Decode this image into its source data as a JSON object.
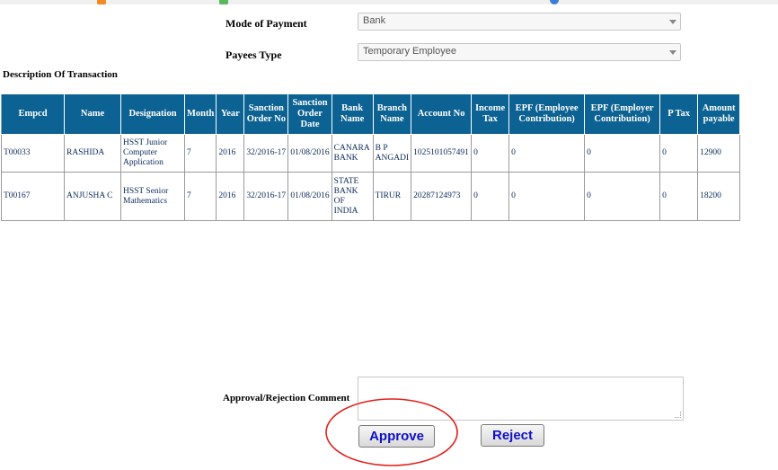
{
  "form": {
    "mode_label": "Mode of Payment",
    "mode_value": "Bank",
    "payee_label": "Payees Type",
    "payee_value": "Temporary Employee"
  },
  "section_title": "Description Of Transaction",
  "table": {
    "headers": [
      "Empcd",
      "Name",
      "Designation",
      "Month",
      "Year",
      "Sanction Order No",
      "Sanction Order Date",
      "Bank Name",
      "Branch Name",
      "Account No",
      "Income Tax",
      "EPF (Employee Contribution)",
      "EPF (Employer Contribution)",
      "P Tax",
      "Amount payable"
    ],
    "rows": [
      [
        "T00033",
        "RASHIDA",
        "HSST Junior Computer Application",
        "7",
        "2016",
        "32/2016-17",
        "01/08/2016",
        "CANARA BANK",
        "B P ANGADI",
        "1025101057491",
        "0",
        "0",
        "0",
        "0",
        "12900"
      ],
      [
        "T00167",
        "ANJUSHA C",
        "HSST Senior Mathematics",
        "7",
        "2016",
        "32/2016-17",
        "01/08/2016",
        "STATE BANK OF INDIA",
        "TIRUR",
        "20287124973",
        "0",
        "0",
        "0",
        "0",
        "18200"
      ]
    ]
  },
  "comment": {
    "label": "Approval/Rejection Comment",
    "value": ""
  },
  "buttons": {
    "approve": "Approve",
    "reject": "Reject"
  },
  "colors": {
    "header_bg": "#0c6292",
    "highlight": "#e0201c",
    "button_text": "#1010c8"
  }
}
